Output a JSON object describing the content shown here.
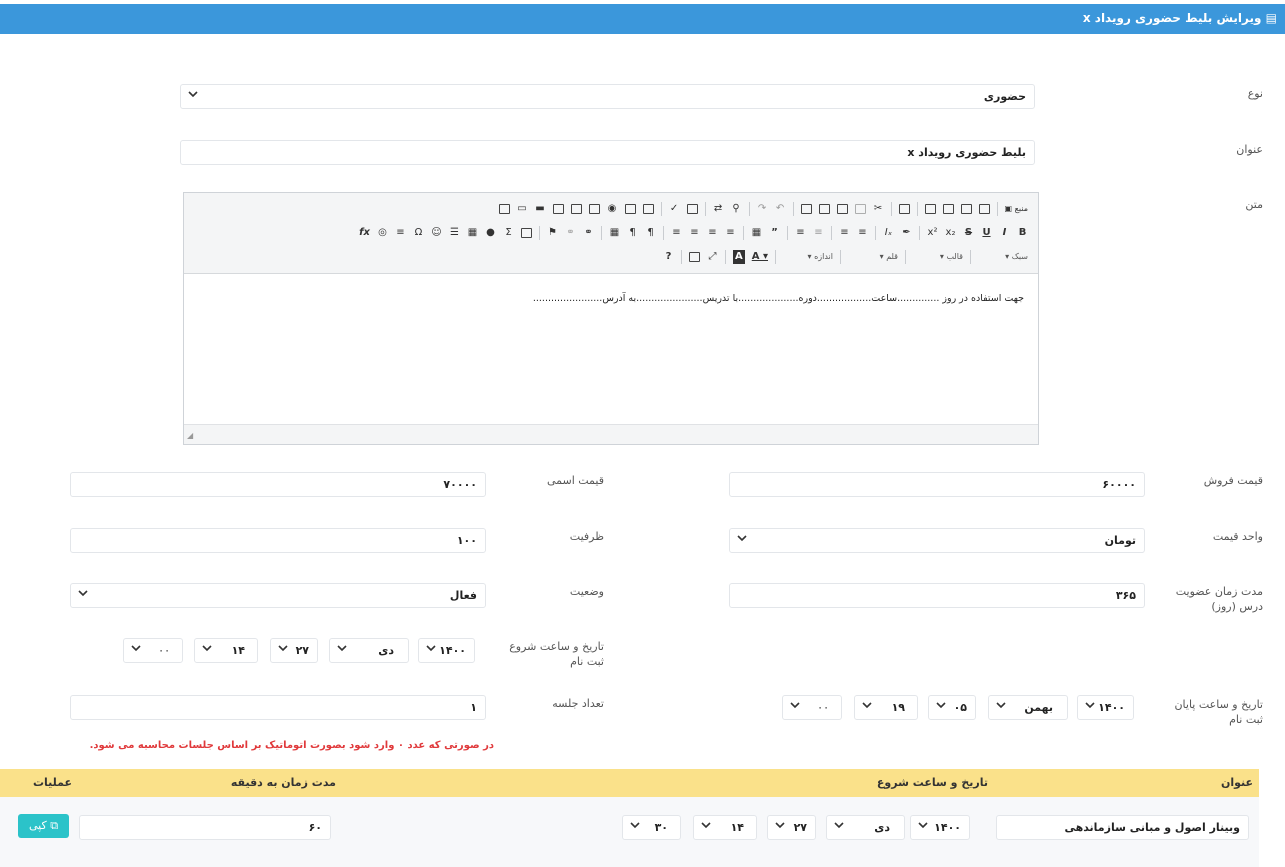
{
  "header": {
    "title": "ویرایش بلیط حضوری رویداد x"
  },
  "form": {
    "type": {
      "label": "نوع",
      "value": "حضوری"
    },
    "title": {
      "label": "عنوان",
      "value": "بلیط حضوری رویداد x"
    },
    "text": {
      "label": "متن",
      "content": "جهت استفاده در روز ..............ساعت..................دوره....................با تدریس......................به آدرس.......................",
      "toolbar_row1": [
        "منبع",
        "ذخیره",
        "سند جدید",
        "پیش‌نمایش",
        "چاپ",
        "قالب‌ها",
        "برش",
        "کپی",
        "چسباندن",
        "چسباندن متن",
        "چسباندن از Word",
        "برگشت",
        "انجام مجدد",
        "جستجو",
        "جایگزینی",
        "انتخاب همه",
        "غلط‌یاب",
        "فرم",
        "چک‌باکس",
        "دکمه رادیویی",
        "فیلد متنی",
        "ناحیه متنی",
        "انتخاب",
        "دکمه",
        "دکمه تصویری",
        "فیلد مخفی",
        "نمایش بلوک‌ها"
      ],
      "toolbar_row2": [
        "B",
        "I",
        "U",
        "S",
        "x₂",
        "x²",
        "حذف قالب",
        "پاک کردن قالب",
        "فهرست شماره‌دار",
        "فهرست نقطه‌ای",
        "کاهش تورفتگی",
        "افزایش تورفتگی",
        "نقل قول",
        "Div",
        "چپ‌چین",
        "وسط‌چین",
        "راست‌چین",
        "تراز کامل",
        "چپ به راست",
        "راست به چپ",
        "زبان",
        "پیوند",
        "حذف پیوند",
        "لنگر",
        "تصویر",
        "جدول",
        "Σ",
        "فلش",
        "خط افقی",
        "شکلک",
        "Ω",
        "صفحه‌بندی",
        "iFrame",
        "fx"
      ],
      "toolbar_row3": {
        "style": "سبک",
        "format": "قالب",
        "font": "قلم",
        "size": "اندازه",
        "text_color": "A",
        "bg_color": "A",
        "maximize": "بزرگ‌نمایی",
        "show_blocks": "نمایش بلوک",
        "help": "?"
      }
    },
    "sale_price": {
      "label": "قیمت فروش",
      "value": "۶۰۰۰۰"
    },
    "nominal_price": {
      "label": "قیمت اسمی",
      "value": "۷۰۰۰۰"
    },
    "price_unit": {
      "label": "واحد قیمت",
      "value": "تومان"
    },
    "capacity": {
      "label": "ظرفیت",
      "value": "۱۰۰"
    },
    "membership": {
      "label1": "مدت زمان عضویت",
      "label2": "درس (روز)",
      "value": "۳۶۵"
    },
    "status": {
      "label": "وضعیت",
      "value": "فعال"
    },
    "reg_start": {
      "label1": "تاریخ و ساعت شروع",
      "label2": "ثبت نام",
      "year": "۱۴۰۰",
      "month": "دی",
      "day": "۲۷",
      "hour": "۱۴",
      "minute": "۰۰"
    },
    "reg_end": {
      "label1": "تاریخ و ساعت پایان",
      "label2": "ثبت نام",
      "year": "۱۴۰۰",
      "month": "بهمن",
      "day": "۰۵",
      "hour": "۱۹",
      "minute": "۰۰"
    },
    "sessions": {
      "label": "تعداد جلسه",
      "value": "۱",
      "note": "در صورتی که عدد ۰ وارد شود بصورت اتوماتیک بر اساس جلسات محاسبه می شود."
    }
  },
  "table": {
    "headers": {
      "title": "عنوان",
      "start": "تاریخ و ساعت شروع",
      "duration": "مدت زمان به دقیقه",
      "ops": "عملیات"
    },
    "rows": [
      {
        "title": "وبینار اصول و مبانی سازماندهی",
        "year": "۱۴۰۰",
        "month": "دی",
        "day": "۲۷",
        "hour": "۱۴",
        "minute": "۳۰",
        "duration": "۶۰",
        "copy_label": "کپی"
      }
    ]
  },
  "colors": {
    "header": "#3b97db",
    "table_header": "#fae18a",
    "copy_button": "#2bc3c9",
    "warning": "#e0393b"
  }
}
